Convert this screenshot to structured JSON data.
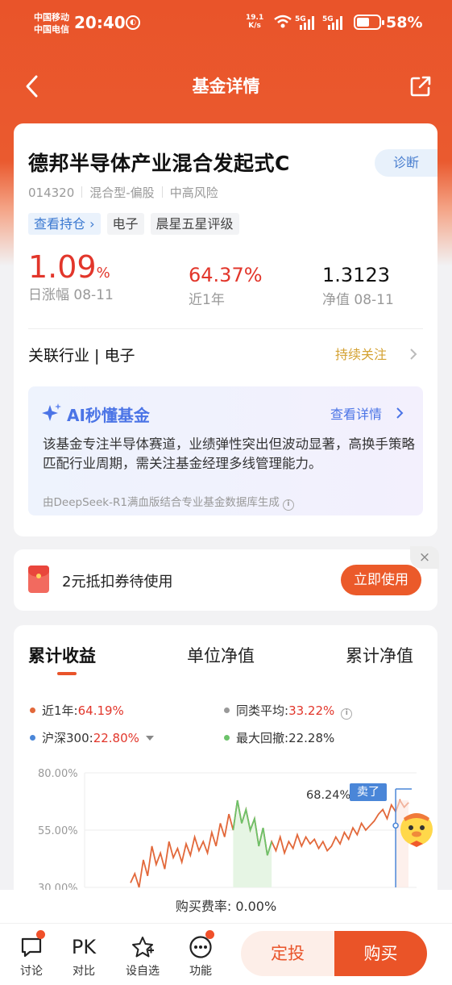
{
  "status_bar": {
    "carrier1": "中国移动",
    "carrier2": "中国电信",
    "time": "20:40",
    "net_speed_value": "19.1",
    "net_speed_unit": "K/s",
    "battery_pct": "58%",
    "battery_level": 0.58
  },
  "nav": {
    "title": "基金详情"
  },
  "fund": {
    "name": "德邦半导体产业混合发起式C",
    "code": "014320",
    "type": "混合型-偏股",
    "risk": "中高风险",
    "diagnose_label": "诊断",
    "tags": [
      "查看持仓 ›",
      "电子",
      "晨星五星评级"
    ],
    "daily_change": "1.09",
    "daily_change_unit": "%",
    "daily_change_label": "日涨幅 08-11",
    "one_year": "64.37%",
    "one_year_label": "近1年",
    "nav_value": "1.3123",
    "nav_label": "净值 08-11",
    "industry": "关联行业 | 电子",
    "follow_label": "持续关注"
  },
  "ai": {
    "title": "AI秒懂基金",
    "more_label": "查看详情",
    "text": "该基金专注半导体赛道，业绩弹性突出但波动显著，高换手策略匹配行业周期，需关注基金经理多线管理能力。",
    "source": "由DeepSeek-R1满血版结合专业基金数据库生成"
  },
  "coupon": {
    "text": "2元抵扣券待使用",
    "button": "立即使用",
    "close": "×"
  },
  "chart_section": {
    "tabs": [
      "累计收益",
      "单位净值",
      "累计净值"
    ],
    "legend": {
      "fund_label": "近1年:",
      "fund_value": "64.19%",
      "peer_label": "同类平均:",
      "peer_value": "33.22%",
      "index_label": "沪深300:",
      "index_value": "22.80%",
      "drawdown_label": "最大回撤:",
      "drawdown_value": "22.28%"
    },
    "sell_tag": "卖了",
    "peak_label": "68.24%",
    "colors": {
      "fund": "#e2683a",
      "peer": "#999999",
      "index": "#4a86d8",
      "drawdown": "#6cc36a"
    }
  },
  "chart_data": {
    "type": "line",
    "yticks": [
      "80.00%",
      "55.00%",
      "30.00%"
    ],
    "ylim": [
      30,
      80
    ],
    "series": [
      {
        "name": "近1年",
        "values": [
          32,
          36,
          30,
          42,
          35,
          48,
          40,
          45,
          38,
          50,
          43,
          47,
          41,
          49,
          44,
          52,
          46,
          50,
          45,
          54,
          48,
          58,
          52,
          62,
          55,
          68,
          58,
          64,
          55,
          60,
          48,
          56,
          44,
          50,
          46,
          52,
          45,
          50,
          47,
          53,
          48,
          52,
          49,
          51,
          47,
          50,
          46,
          48,
          52,
          49,
          54,
          51,
          56,
          53,
          58,
          55,
          57,
          59,
          62,
          64,
          60,
          66,
          63,
          68,
          65,
          67
        ]
      }
    ]
  },
  "bottom": {
    "fee": "购买费率: 0.00%",
    "tools": [
      "讨论",
      "对比",
      "设自选",
      "功能"
    ],
    "pk_text": "PK",
    "dingtou": "定投",
    "buy": "购买"
  }
}
